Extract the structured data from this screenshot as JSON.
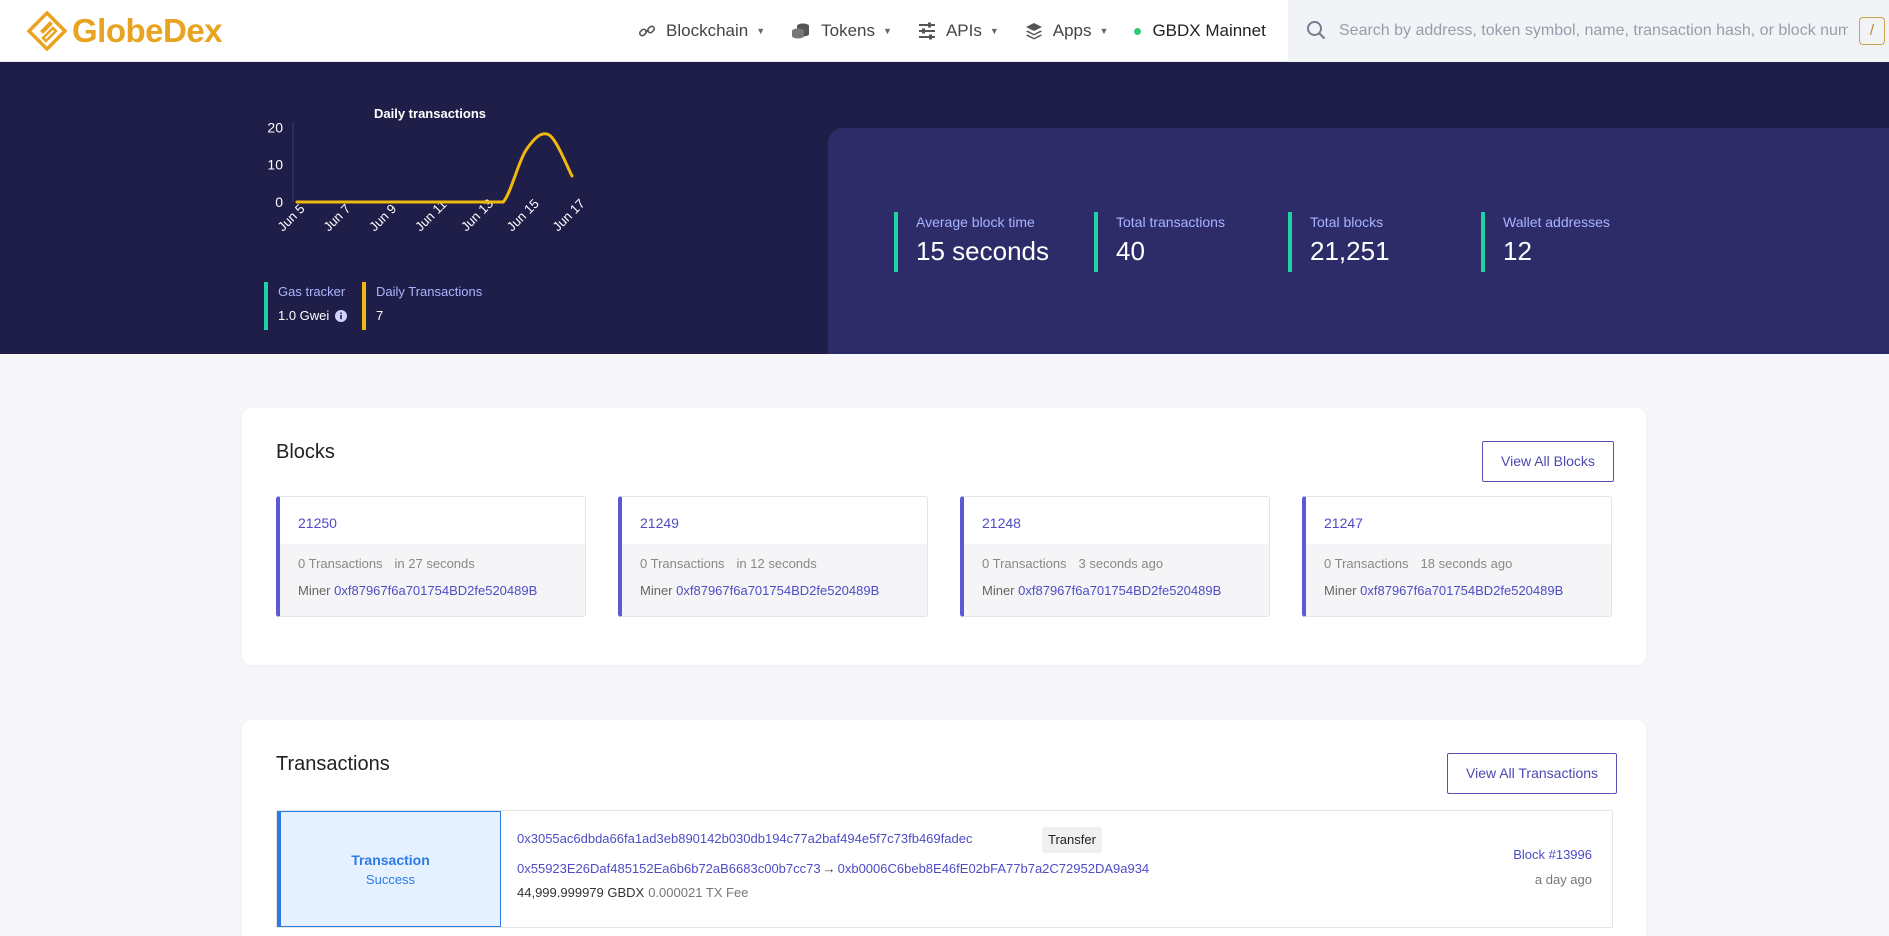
{
  "brand": {
    "name": "GlobeDex",
    "accent": "#e8a321"
  },
  "nav": {
    "items": [
      {
        "label": "Blockchain",
        "icon": "link-icon"
      },
      {
        "label": "Tokens",
        "icon": "coins-icon"
      },
      {
        "label": "APIs",
        "icon": "sliders-icon"
      },
      {
        "label": "Apps",
        "icon": "layers-icon"
      }
    ],
    "network": "GBDX Mainnet"
  },
  "search": {
    "placeholder": "Search by address, token symbol, name, transaction hash, or block number",
    "shortcut": "/"
  },
  "chart_data": {
    "type": "line",
    "title": "Daily transactions",
    "x": [
      "Jun 5",
      "Jun 6",
      "Jun 7",
      "Jun 8",
      "Jun 9",
      "Jun 10",
      "Jun 11",
      "Jun 12",
      "Jun 13",
      "Jun 14",
      "Jun 15",
      "Jun 16",
      "Jun 17"
    ],
    "x_tick_labels": [
      "Jun 5",
      "Jun 7",
      "Jun 9",
      "Jun 11",
      "Jun 13",
      "Jun 15",
      "Jun 17"
    ],
    "series": [
      {
        "values": [
          0,
          0,
          0,
          0,
          0,
          0,
          0,
          0,
          0,
          0,
          14,
          18,
          7
        ]
      }
    ],
    "yticks": [
      0,
      10,
      20
    ],
    "ylim": [
      0,
      22
    ],
    "xlim": [
      "Jun 5",
      "Jun 17"
    ],
    "line_color": "#f1b80e",
    "grid": false,
    "legend": "none"
  },
  "hero": {
    "gas": {
      "label": "Gas tracker",
      "value": "1.0 Gwei"
    },
    "daily": {
      "label": "Daily Transactions",
      "value": "7"
    },
    "stats": [
      {
        "label": "Average block time",
        "value": "15 seconds"
      },
      {
        "label": "Total transactions",
        "value": "40"
      },
      {
        "label": "Total blocks",
        "value": "21,251"
      },
      {
        "label": "Wallet addresses",
        "value": "12"
      }
    ]
  },
  "blocks": {
    "title": "Blocks",
    "view_all": "View All Blocks",
    "items": [
      {
        "number": "21250",
        "txs": "0 Transactions",
        "time": "in 27 seconds",
        "miner_label": "Miner",
        "miner": "0xf87967f6a701754BD2fe520489B"
      },
      {
        "number": "21249",
        "txs": "0 Transactions",
        "time": "in 12 seconds",
        "miner_label": "Miner",
        "miner": "0xf87967f6a701754BD2fe520489B"
      },
      {
        "number": "21248",
        "txs": "0 Transactions",
        "time": "3 seconds ago",
        "miner_label": "Miner",
        "miner": "0xf87967f6a701754BD2fe520489B"
      },
      {
        "number": "21247",
        "txs": "0 Transactions",
        "time": "18 seconds ago",
        "miner_label": "Miner",
        "miner": "0xf87967f6a701754BD2fe520489B"
      }
    ]
  },
  "transactions": {
    "title": "Transactions",
    "view_all": "View All Transactions",
    "items": [
      {
        "type": "Transaction",
        "status": "Success",
        "hash": "0x3055ac6dbda66fa1ad3eb890142b030db194c77a2baf494e5f7c73fb469fadec",
        "badge": "Transfer",
        "from": "0x55923E26Daf485152Ea6b6b72aB6683c00b7cc73",
        "arrow": "→",
        "to": "0xb0006C6beb8E46fE02bFA77b7a2C72952DA9a934",
        "value": "44,999.999979 GBDX",
        "fee": "0.000021 TX Fee",
        "block": "Block #13996",
        "time": "a day ago"
      }
    ]
  }
}
